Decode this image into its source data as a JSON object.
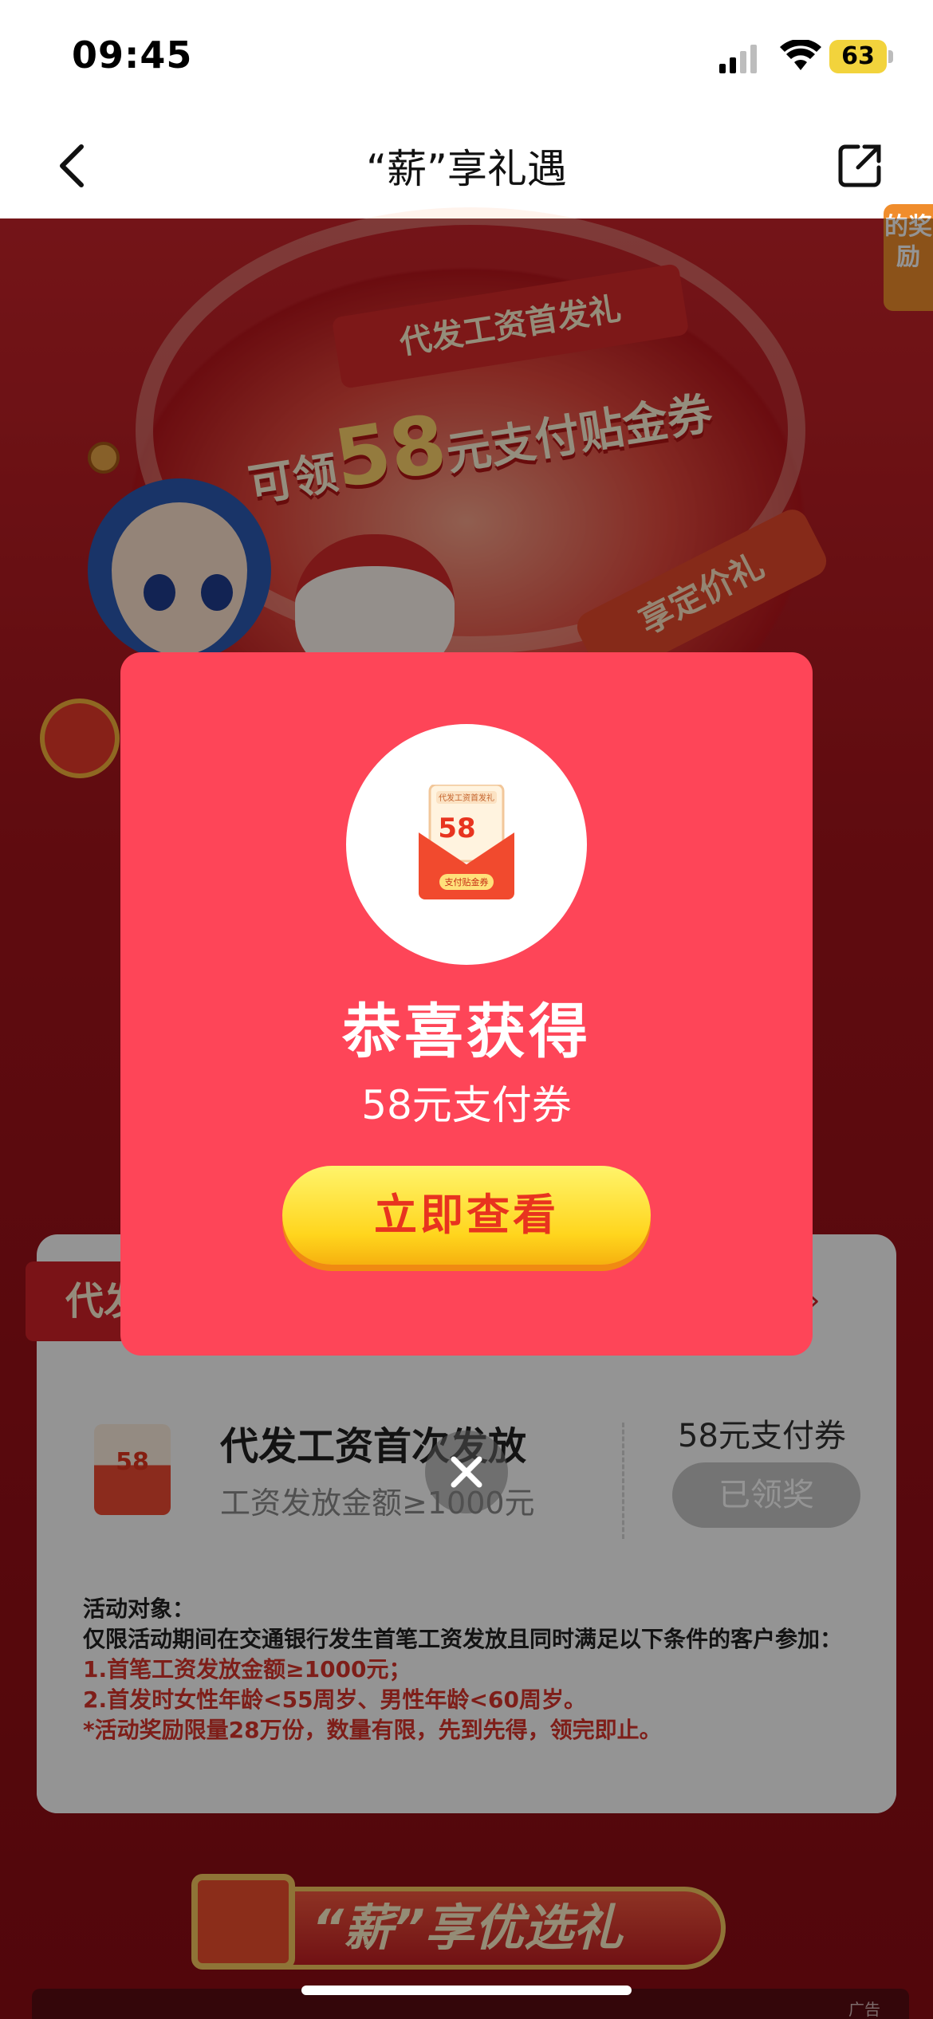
{
  "status_bar": {
    "time": "09:45",
    "battery": "63"
  },
  "nav": {
    "title": "“薪”享礼遇"
  },
  "banner": {
    "subtitle": "代发工资首发礼",
    "coupon_prefix": "可领",
    "coupon_amount": "58",
    "coupon_suffix": "元支付贴金券",
    "side_tag": "的奖励",
    "ribbon": "享定价礼"
  },
  "card": {
    "label": "代发",
    "rules_link": "则 ›",
    "task": {
      "icon_amount": "58",
      "title": "代发工资首次发放",
      "desc": "工资发放金额≥1000元",
      "reward": "58元支付券",
      "button": "已领奖"
    },
    "rules": {
      "heading": "活动对象：",
      "line1": "仅限活动期间在交通银行发生首笔工资发放且同时满足以下条件的客户参加：",
      "cond1": "1.首笔工资发放金额≥1000元；",
      "cond2": "2.首发时女性年龄<55周岁、男性年龄<60周岁。",
      "note": "*活动奖励限量28万份，数量有限，先到先得，领完即止。"
    }
  },
  "bottom_banner": {
    "text": "“薪”享优选礼"
  },
  "ad": {
    "label": "广告"
  },
  "modal": {
    "title": "恭喜获得",
    "subtitle": "58元支付券",
    "button": "立即查看",
    "coupon_amount": "58",
    "coupon_tag": "支付贴金券",
    "coupon_header": "代发工资首发礼"
  },
  "colors": {
    "modal_bg": "#fe4558",
    "button_yellow": "#ffd51d",
    "accent_red": "#d32229"
  }
}
